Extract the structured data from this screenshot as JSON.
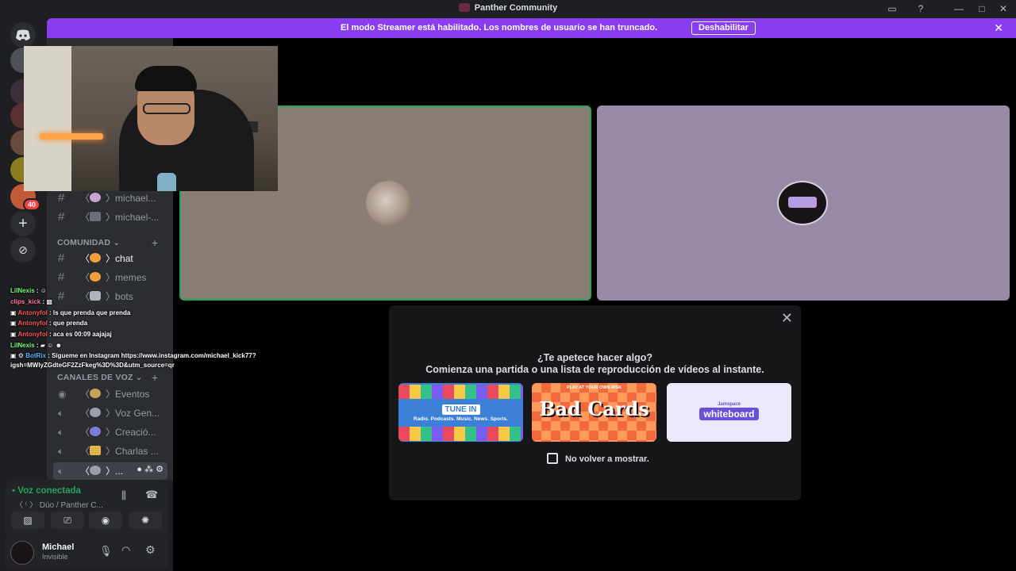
{
  "window": {
    "title": "Panther Community"
  },
  "banner": {
    "message": "El modo Streamer está habilitado. Los nombres de usuario se han truncado.",
    "button_label": "Deshabilitar"
  },
  "guilds": {
    "badge_count": "40"
  },
  "channels": {
    "top_items": [
      {
        "label": "michael...",
        "icon": "paint-icon"
      },
      {
        "label": "michael-...",
        "icon": "frame-icon"
      }
    ],
    "community_category": "COMUNIDAD",
    "community_items": [
      {
        "label": "chat",
        "icon": "smile-icon"
      },
      {
        "label": "memes",
        "icon": "laugh-icon"
      },
      {
        "label": "bots",
        "icon": "robot-icon"
      }
    ],
    "voice_category": "CANALES DE VOZ",
    "voice_items": [
      {
        "label": "Eventos",
        "icon": "stage-icon"
      },
      {
        "label": "Voz Gen...",
        "icon": "mic-icon"
      },
      {
        "label": "Creació...",
        "icon": "gamepad-icon"
      },
      {
        "label": "Charlas ...",
        "icon": "lock-icon"
      },
      {
        "label": "...",
        "icon": "mic-icon"
      }
    ]
  },
  "voice_panel": {
    "status": "Voz conectada",
    "channel": "Dúo / Panther C..."
  },
  "user_panel": {
    "name": "Michael",
    "status": "Invisible"
  },
  "modal": {
    "heading": "¿Te apetece hacer algo?",
    "subheading": "Comienza una partida o una lista de reproducción de vídeos al instante.",
    "activities": [
      {
        "name": "TUNE IN",
        "caption": "Radio. Podcasts. Music. News. Sports."
      },
      {
        "name": "Bad Cards",
        "caption": "PLAY AT YOUR OWN RISK"
      },
      {
        "name": "whiteboard",
        "caption": "Jamspace"
      }
    ],
    "checkbox_label": "No volver a mostrar."
  },
  "stream_chat": [
    {
      "user": "LilNexis",
      "text": "",
      "color": "#7cfc7c"
    },
    {
      "user": "clips_kick",
      "text": "",
      "color": "#ff7aa2"
    },
    {
      "user": "Antonyfol",
      "text": "ls que prenda que prenda",
      "color": "#ff5959"
    },
    {
      "user": "Antonyfol",
      "text": "que prenda",
      "color": "#ff5959"
    },
    {
      "user": "Antonyfol",
      "text": "aca es 00:09 aajajaj",
      "color": "#ff5959"
    },
    {
      "user": "LilNexis",
      "text": "",
      "color": "#7cfc7c"
    },
    {
      "user": "BotRix",
      "text": "Sígueme en Instagram https://www.instagram.com/michael_kick77?",
      "color": "#59b8ff"
    },
    {
      "user": "",
      "text": "igsh=MWlyZGdteGF2ZzFkeg%3D%3D&utm_source=qr",
      "color": "#ffffff"
    }
  ]
}
